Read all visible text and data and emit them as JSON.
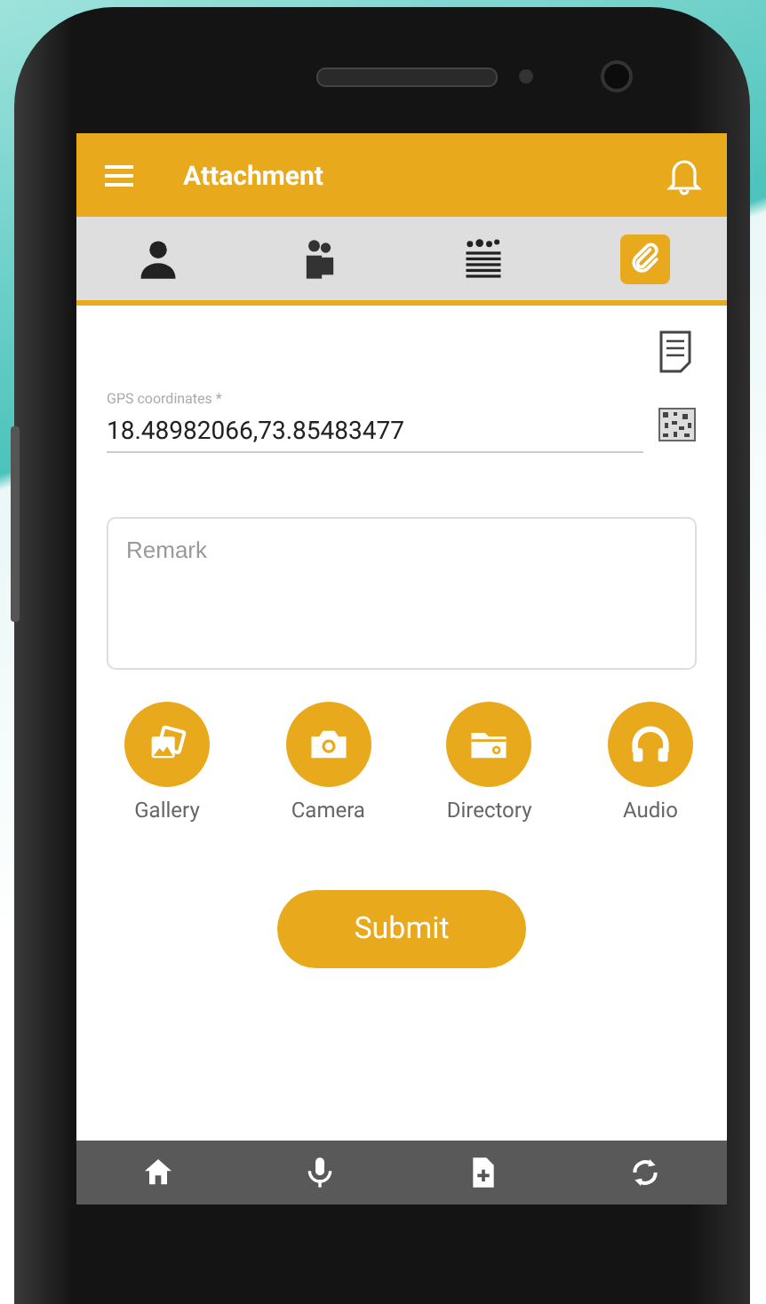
{
  "app_bar": {
    "title": "Attachment"
  },
  "tabs": [
    {
      "kind": "person",
      "selected": false
    },
    {
      "kind": "family",
      "selected": false
    },
    {
      "kind": "field",
      "selected": false
    },
    {
      "kind": "attachment",
      "selected": true
    }
  ],
  "gps_field": {
    "label": "GPS coordinates *",
    "value": "18.48982066,73.85483477"
  },
  "remark_field": {
    "placeholder": "Remark"
  },
  "actions": [
    {
      "kind": "gallery",
      "label": "Gallery"
    },
    {
      "kind": "camera",
      "label": "Camera"
    },
    {
      "kind": "directory",
      "label": "Directory"
    },
    {
      "kind": "audio",
      "label": "Audio"
    }
  ],
  "submit_button": {
    "label": "Submit"
  },
  "bottom_nav": [
    {
      "kind": "home"
    },
    {
      "kind": "microphone"
    },
    {
      "kind": "add-file"
    },
    {
      "kind": "sync"
    }
  ]
}
